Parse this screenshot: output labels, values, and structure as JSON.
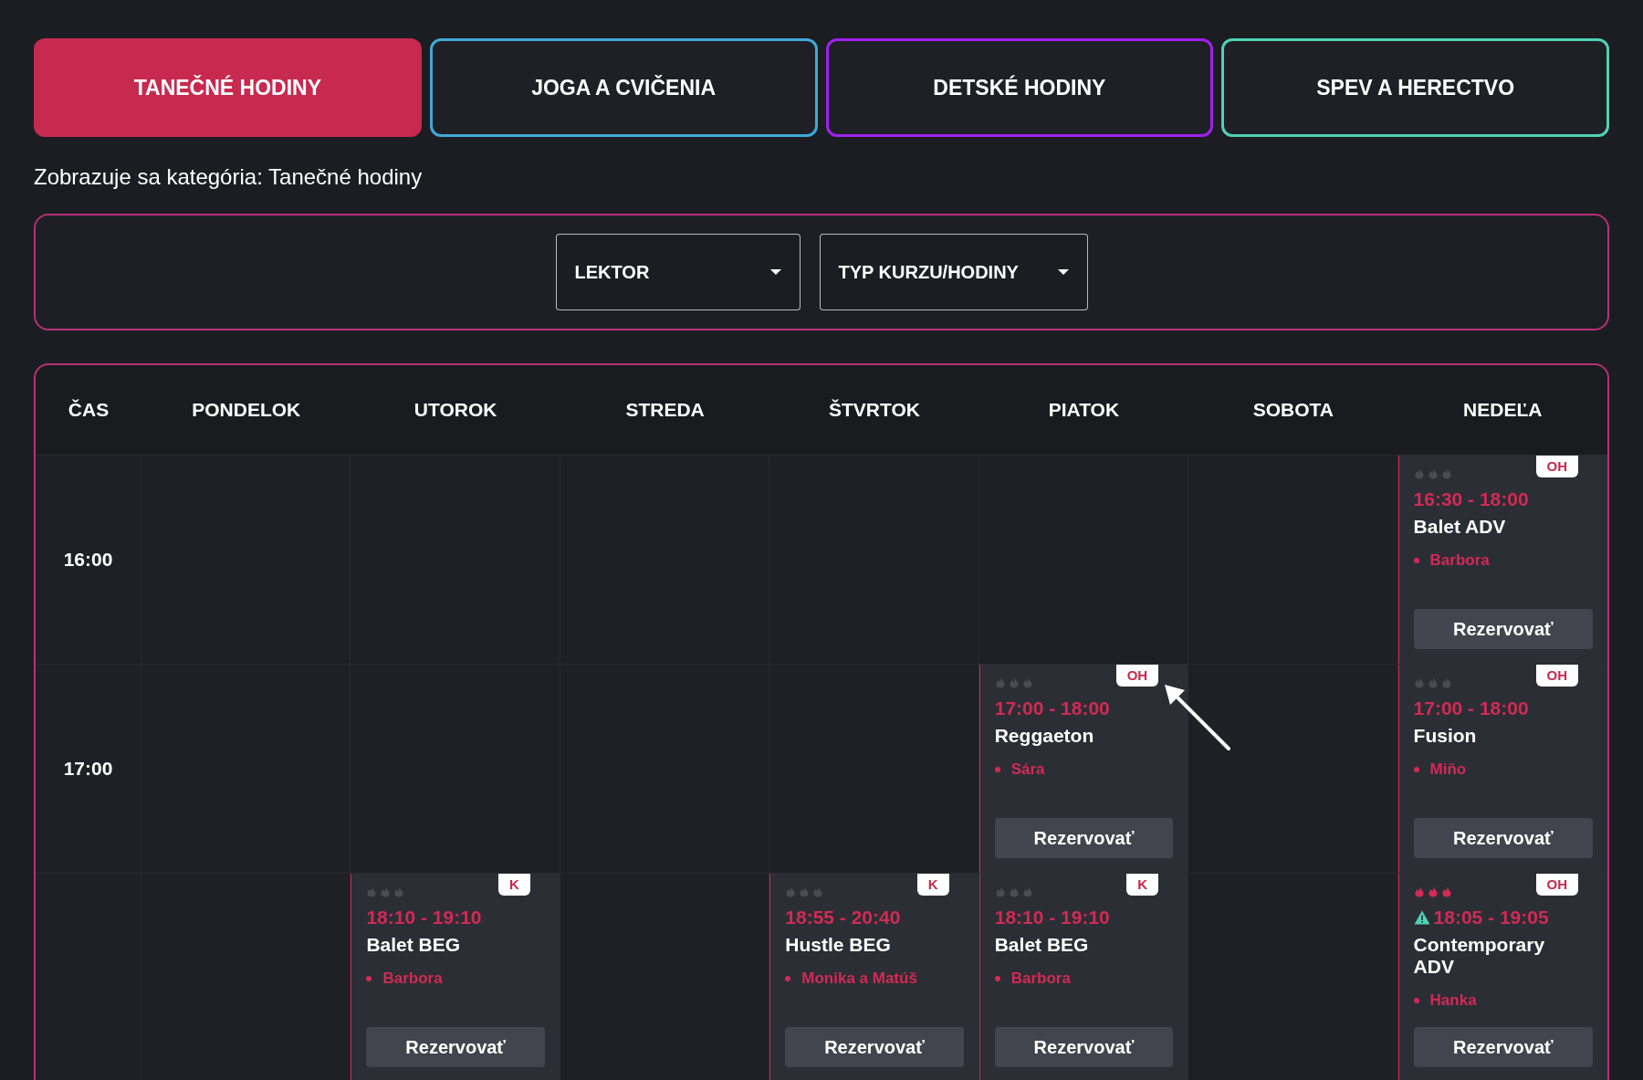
{
  "tabs": [
    {
      "label": "TANEČNÉ HODINY",
      "selected": true,
      "color": "#c8294f"
    },
    {
      "label": "JOGA A CVIČENIA",
      "selected": false,
      "color": "#3fa9d8"
    },
    {
      "label": "DETSKÉ HODINY",
      "selected": false,
      "color": "#a020f0"
    },
    {
      "label": "SPEV A HERECTVO",
      "selected": false,
      "color": "#4fd1b5"
    }
  ],
  "caption": "Zobrazuje sa kategória: Tanečné hodiny",
  "filters": [
    {
      "label": "LEKTOR"
    },
    {
      "label": "TYP KURZU/HODINY"
    }
  ],
  "table": {
    "columns": [
      "ČAS",
      "PONDELOK",
      "UTOROK",
      "STREDA",
      "ŠTVRTOK",
      "PIATOK",
      "SOBOTA",
      "NEDEĽA"
    ],
    "rows": [
      {
        "cells": [
          {
            "kind": "time",
            "text": "16:00"
          },
          {
            "kind": "empty"
          },
          {
            "kind": "empty"
          },
          {
            "kind": "empty"
          },
          {
            "kind": "empty"
          },
          {
            "kind": "empty"
          },
          {
            "kind": "empty"
          },
          {
            "kind": "event",
            "badge": "OH",
            "stars": 0,
            "time": "16:30 - 18:00",
            "title": "Balet ADV",
            "lector": "Barbora",
            "button": "Rezervovať"
          }
        ]
      },
      {
        "cells": [
          {
            "kind": "time",
            "text": "17:00"
          },
          {
            "kind": "empty"
          },
          {
            "kind": "empty"
          },
          {
            "kind": "empty"
          },
          {
            "kind": "empty"
          },
          {
            "kind": "event",
            "badge": "OH",
            "stars": 0,
            "pointer": true,
            "time": "17:00 - 18:00",
            "title": "Reggaeton",
            "lector": "Sára",
            "button": "Rezervovať"
          },
          {
            "kind": "empty"
          },
          {
            "kind": "event",
            "badge": "OH",
            "stars": 0,
            "time": "17:00 - 18:00",
            "title": "Fusion",
            "lector": "Miňo",
            "button": "Rezervovať"
          }
        ]
      },
      {
        "cells": [
          {
            "kind": "empty"
          },
          {
            "kind": "empty"
          },
          {
            "kind": "event",
            "badge": "K",
            "stars": 0,
            "time": "18:10 - 19:10",
            "title": "Balet BEG",
            "lector": "Barbora",
            "button": "Rezervovať"
          },
          {
            "kind": "empty"
          },
          {
            "kind": "event",
            "badge": "K",
            "stars": 0,
            "time": "18:55 - 20:40",
            "title": "Hustle BEG",
            "lector": "Monika a Matúš",
            "button": "Rezervovať"
          },
          {
            "kind": "event",
            "badge": "K",
            "stars": 0,
            "time": "18:10 - 19:10",
            "title": "Balet BEG",
            "lector": "Barbora",
            "button": "Rezervovať"
          },
          {
            "kind": "empty"
          },
          {
            "kind": "event",
            "badge": "OH",
            "stars": 3,
            "warning": true,
            "time": "18:05 - 19:05",
            "title": "Contemporary ADV",
            "lector": "Hanka",
            "button": "Rezervovať"
          }
        ]
      }
    ]
  }
}
